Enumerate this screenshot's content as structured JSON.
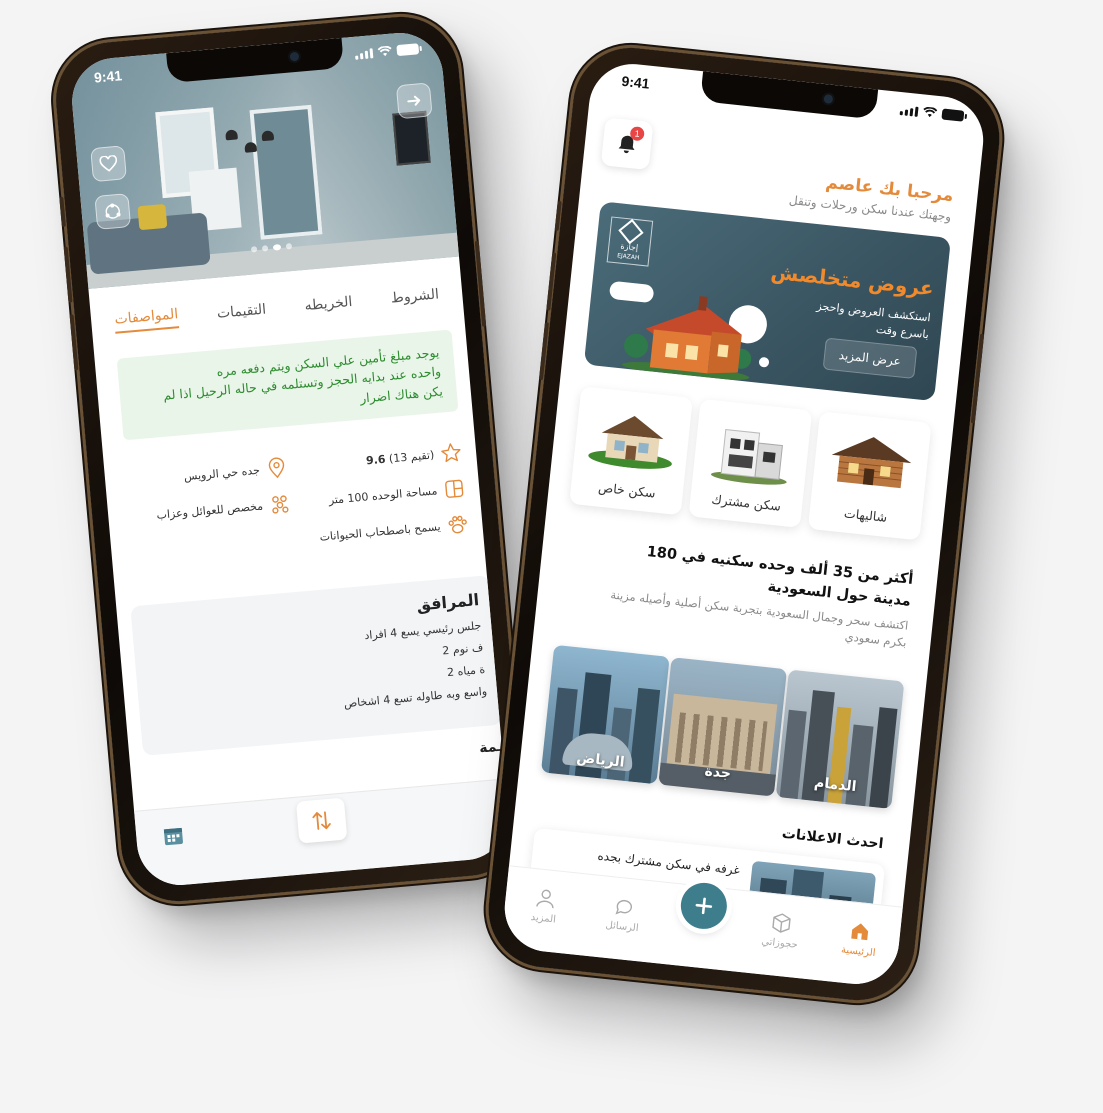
{
  "phone_a": {
    "status_time": "9:41",
    "tabs": [
      {
        "label": "المواصفات",
        "active": true
      },
      {
        "label": "التقيمات",
        "active": false
      },
      {
        "label": "الخريطه",
        "active": false
      },
      {
        "label": "الشروط",
        "active": false
      }
    ],
    "notice_lines": [
      "يوجد مبلغ تأمين علي السكن ويتم دفعه مره",
      "واحده عند بدايه  الحجز وتستلمه  في حاله الرحيل اذا لم",
      "يكن هناك اضرار"
    ],
    "rating_prefix": "(تقيم 13)",
    "rating_value": "9.6",
    "location": "جده حي الرويس",
    "area": "مساحة الوحده 100 متر",
    "audience": "مخصص للعوائل وعزاب",
    "pets": "يسمح باصطحاب الحيوانات",
    "amenities_title": "المرافق",
    "amenities": [
      "جلس رئيسي يسع 4 افراد",
      "ف نوم 2",
      "ة مياه 2",
      "واسع وبه طاوله تسع 4 اشخاص"
    ],
    "next_section": "ـمة",
    "icons": {
      "favorite": "heart-icon",
      "share": "share-icon",
      "next": "arrow-right-icon",
      "calendar": "calendar-icon",
      "swap": "swap-vertical-icon"
    }
  },
  "phone_b": {
    "status_time": "9:41",
    "notification_count": "1",
    "greeting": "مرحبا بك عاصم",
    "greeting_sub": "وجهتك عندنا سكن ورحلات وتنقل",
    "promo": {
      "brand_ar": "إجازة",
      "brand_en": "EJAZAH",
      "title": "عروض متخلصش",
      "subtitle": "استكشف العروض واحجز باسرع وقت",
      "button": "عرض المزيد"
    },
    "categories": [
      {
        "label": "سكن خاص"
      },
      {
        "label": "سكن مشترك"
      },
      {
        "label": "شاليهات"
      }
    ],
    "headline": "أكثر من 35 ألف وحده سكنيه في 180 مدينة حول السعودية",
    "headline_sub": "اكتشف سحر وجمال  السعودية بتجربة سكن أصلية وأصيله مزينة بكرم سعودي",
    "cities": [
      {
        "label": "الرياض"
      },
      {
        "label": "جدة"
      },
      {
        "label": "الدمام"
      }
    ],
    "latest_title": "احدث الاعلانات",
    "latest_item": "غرفه في سكن مشترك بجده",
    "tabbar": [
      {
        "label": "الرئيسية",
        "active": true
      },
      {
        "label": "حجوزاتي",
        "active": false
      },
      {
        "label": "",
        "fab": true
      },
      {
        "label": "الرسائل",
        "active": false
      },
      {
        "label": "المزيد",
        "active": false
      }
    ],
    "colors": {
      "accent": "#e48a3b",
      "teal": "#3e7d8c",
      "success_text": "#2d8c2f",
      "badge": "#e84545"
    }
  }
}
